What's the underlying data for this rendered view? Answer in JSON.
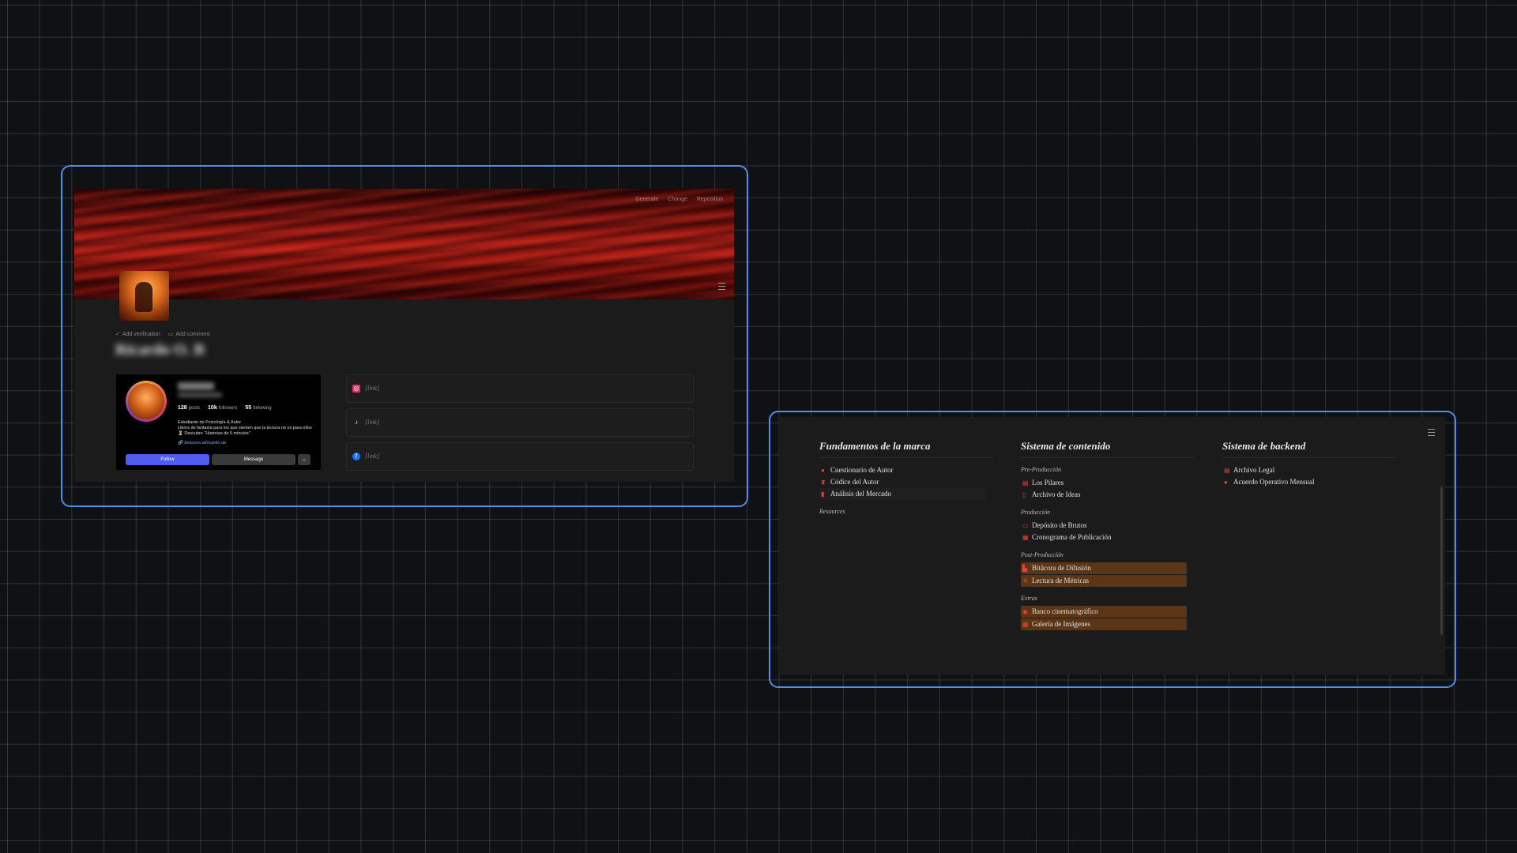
{
  "left_window": {
    "cover_menu": [
      "Generate",
      "Change",
      "Reposition"
    ],
    "meta": {
      "verification": "Add verification",
      "comment": "Add comment"
    },
    "title": "Ricardo O. B",
    "instagram": {
      "stats": [
        {
          "value": "128",
          "label": "posts"
        },
        {
          "value": "10k",
          "label": "followers"
        },
        {
          "value": "55",
          "label": "following"
        }
      ],
      "bio_line1": "Estudiante de Psicología & Autor",
      "bio_line2": "Libros de fantasía para los que sienten que la lectura no es para ellos",
      "bio_line3": "⏳ Descubre \"Historias de 5 minutos\"",
      "link": "🔗 beacons.ai/ricardo.ob",
      "follow": "Follow",
      "message": "Message",
      "more": "⌄"
    },
    "links": [
      {
        "icon": "instagram-icon",
        "color": "#e1306c",
        "text": "[link]"
      },
      {
        "icon": "tiktok-icon",
        "color": "#000000",
        "text": "[link]"
      },
      {
        "icon": "facebook-icon",
        "color": "#1877f2",
        "text": "[link]"
      }
    ]
  },
  "right_window": {
    "col1": {
      "title": "Fundamentos de la marca",
      "items": [
        "Cuestionario de Autor",
        "Códice del Autor",
        "Análisis del Mercado"
      ],
      "resources": "Resources"
    },
    "col2": {
      "title": "Sistema de contenido",
      "sections": [
        {
          "label": "Pre-Producción",
          "items": [
            "Los Pilares",
            "Archivo de Ideas"
          ]
        },
        {
          "label": "Producción",
          "items": [
            "Depósito de Brutos",
            "Cronograma de Publicación"
          ]
        },
        {
          "label": "Post-Producción",
          "items": [
            "Bitácora de Difusión",
            "Lectura de Métricas"
          ]
        },
        {
          "label": "Extras",
          "items": [
            "Banco cinematográfico",
            "Galería de Imágenes"
          ]
        }
      ]
    },
    "col3": {
      "title": "Sistema de backend",
      "items": [
        "Archivo Legal",
        "Acuerdo Operativo Mensual"
      ]
    }
  },
  "colors": {
    "frame": "#4c8fe6",
    "highlight": "#5a3616",
    "icon": "#e0443a"
  }
}
